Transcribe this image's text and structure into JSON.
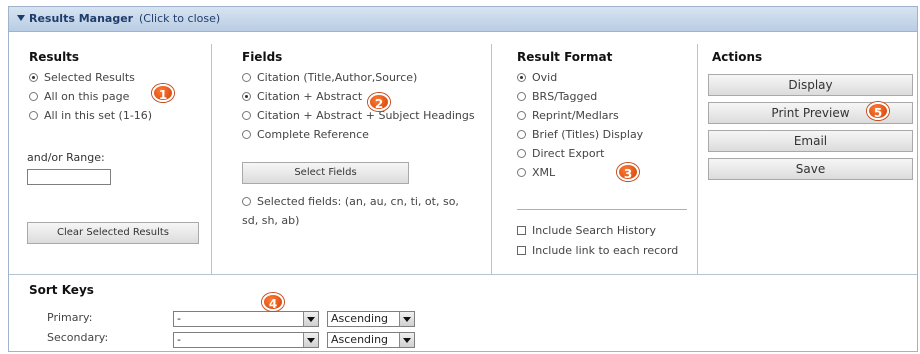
{
  "header": {
    "title": "Results Manager",
    "hint": "(Click to close)"
  },
  "results": {
    "title": "Results",
    "options": [
      {
        "label": "Selected Results",
        "checked": true
      },
      {
        "label": "All on this page",
        "checked": false
      },
      {
        "label": "All in this set (1-16)",
        "checked": false
      }
    ],
    "range_label": "and/or Range:",
    "range_value": "",
    "clear_button": "Clear Selected Results"
  },
  "fields": {
    "title": "Fields",
    "options": [
      {
        "label": "Citation (Title,Author,Source)",
        "checked": false
      },
      {
        "label": "Citation + Abstract",
        "checked": true
      },
      {
        "label": "Citation + Abstract + Subject Headings",
        "checked": false
      },
      {
        "label": "Complete Reference",
        "checked": false
      }
    ],
    "select_button": "Select Fields",
    "selected_fields_line1": "Selected fields: (an, au, cn, ti, ot, so,",
    "selected_fields_line2": "sd, sh, ab)"
  },
  "format": {
    "title": "Result Format",
    "options": [
      {
        "label": "Ovid",
        "checked": true
      },
      {
        "label": "BRS/Tagged",
        "checked": false
      },
      {
        "label": "Reprint/Medlars",
        "checked": false
      },
      {
        "label": "Brief (Titles) Display",
        "checked": false
      },
      {
        "label": "Direct Export",
        "checked": false
      },
      {
        "label": "XML",
        "checked": false
      }
    ],
    "checkboxes": [
      {
        "label": "Include Search History",
        "checked": false
      },
      {
        "label": "Include link to each record",
        "checked": false
      }
    ]
  },
  "actions": {
    "title": "Actions",
    "buttons": [
      "Display",
      "Print Preview",
      "Email",
      "Save"
    ]
  },
  "sort": {
    "title": "Sort Keys",
    "primary_label": "Primary:",
    "secondary_label": "Secondary:",
    "primary_value": "-",
    "secondary_value": "-",
    "primary_order": "Ascending",
    "secondary_order": "Ascending"
  },
  "badges": [
    "1",
    "2",
    "3",
    "4",
    "5"
  ],
  "colors": {
    "header_text": "#1f3d6b",
    "badge": "#e85a1c",
    "border": "#9fb3cc"
  }
}
